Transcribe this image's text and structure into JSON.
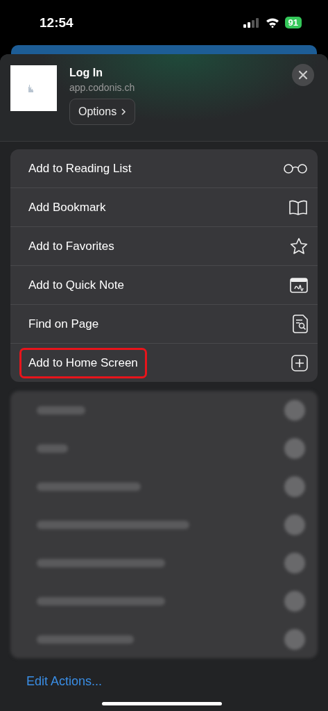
{
  "status_bar": {
    "time": "12:54",
    "battery": "91"
  },
  "header": {
    "title": "Log In",
    "url": "app.codonis.ch",
    "options_button": "Options"
  },
  "actions": [
    {
      "label": "Add to Reading List",
      "highlighted": false
    },
    {
      "label": "Add Bookmark",
      "highlighted": false
    },
    {
      "label": "Add to Favorites",
      "highlighted": false
    },
    {
      "label": "Add to Quick Note",
      "highlighted": false
    },
    {
      "label": "Find on Page",
      "highlighted": false
    },
    {
      "label": "Add to Home Screen",
      "highlighted": true
    }
  ],
  "edit_actions": "Edit Actions..."
}
